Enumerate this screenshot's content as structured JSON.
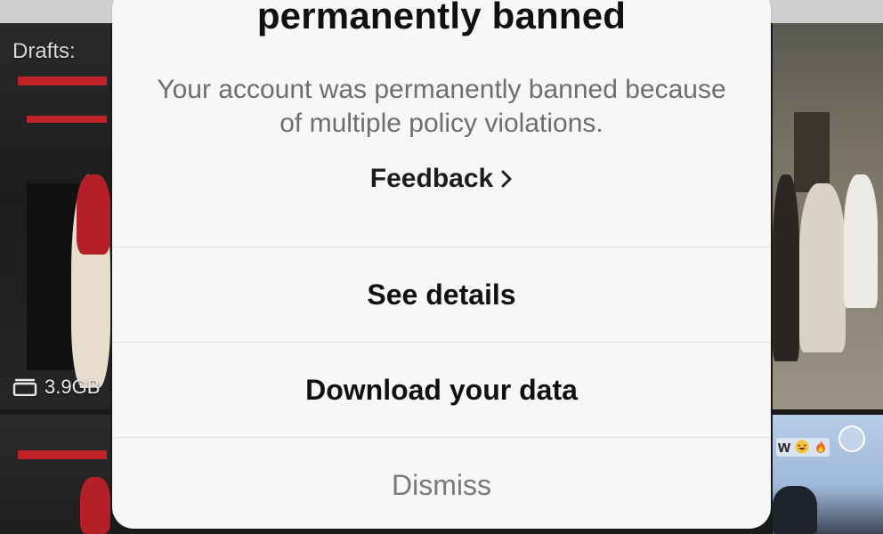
{
  "background": {
    "drafts_label": "Drafts:",
    "storage_size": "3.9GB",
    "corner_caption": "w"
  },
  "modal": {
    "title": "permanently banned",
    "message": "Your account was permanently banned because of multiple policy violations.",
    "feedback_link": "Feedback",
    "actions": [
      {
        "label": "See details"
      },
      {
        "label": "Download your data"
      },
      {
        "label": "Dismiss"
      }
    ]
  },
  "colors": {
    "sheet": "#f7f7f7",
    "title": "#111111",
    "message": "#6e6e6e",
    "dismiss": "#7a7a7a",
    "divider": "#e1e1e1"
  },
  "icons": [
    "stack-icon",
    "chevron-right-icon",
    "laughing-emoji-icon",
    "fire-emoji-icon",
    "select-circle-icon"
  ]
}
